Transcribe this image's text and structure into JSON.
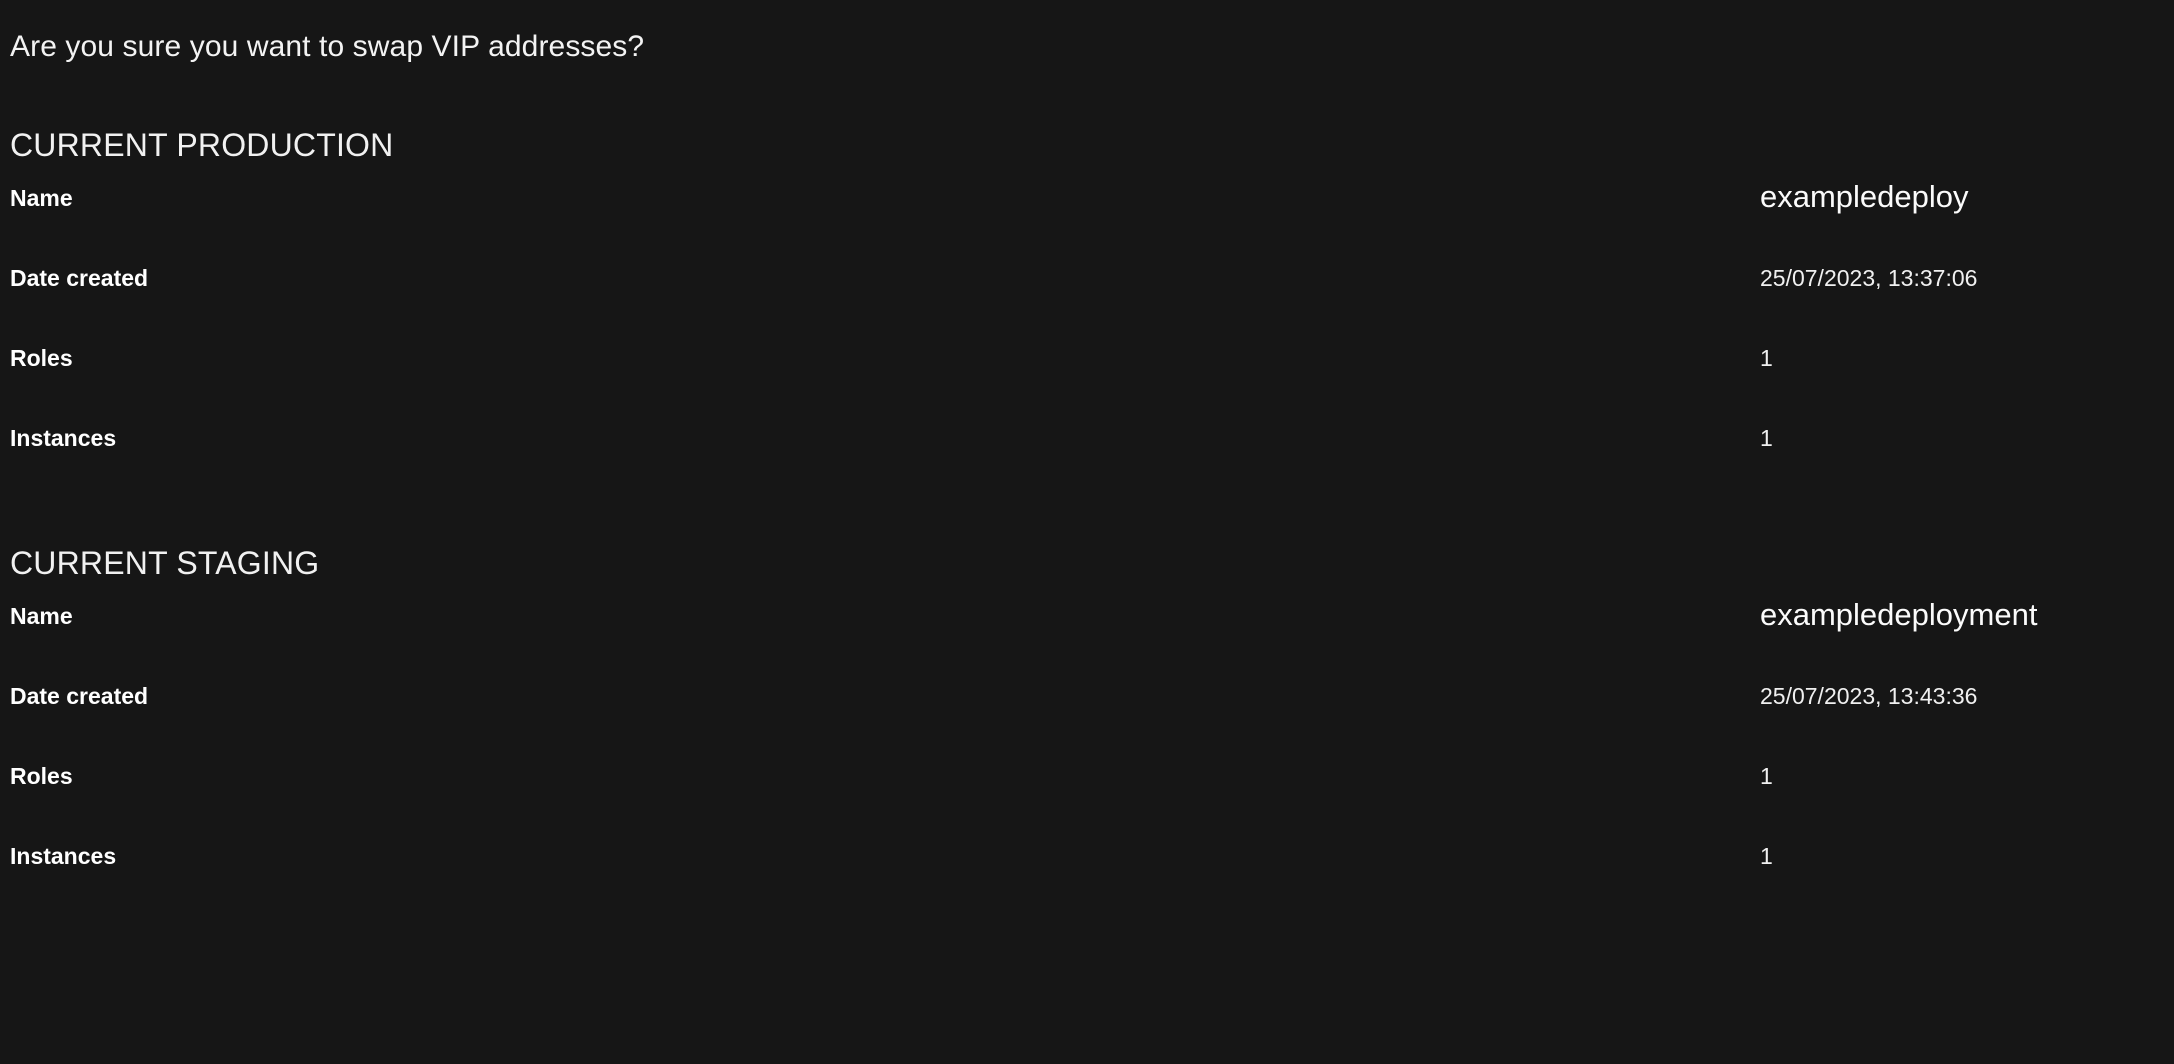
{
  "dialog": {
    "question": "Are you sure you want to swap VIP addresses?"
  },
  "sections": [
    {
      "heading": "CURRENT PRODUCTION",
      "rows": [
        {
          "label": "Name",
          "value": "exampledeploy"
        },
        {
          "label": "Date created",
          "value": "25/07/2023, 13:37:06"
        },
        {
          "label": "Roles",
          "value": "1"
        },
        {
          "label": "Instances",
          "value": "1"
        }
      ]
    },
    {
      "heading": "CURRENT STAGING",
      "rows": [
        {
          "label": "Name",
          "value": "exampledeployment"
        },
        {
          "label": "Date created",
          "value": "25/07/2023, 13:43:36"
        },
        {
          "label": "Roles",
          "value": "1"
        },
        {
          "label": "Instances",
          "value": "1"
        }
      ]
    }
  ],
  "colors": {
    "background": "#161616",
    "text_primary": "#ffffff",
    "text_secondary": "#f0f0f0"
  }
}
